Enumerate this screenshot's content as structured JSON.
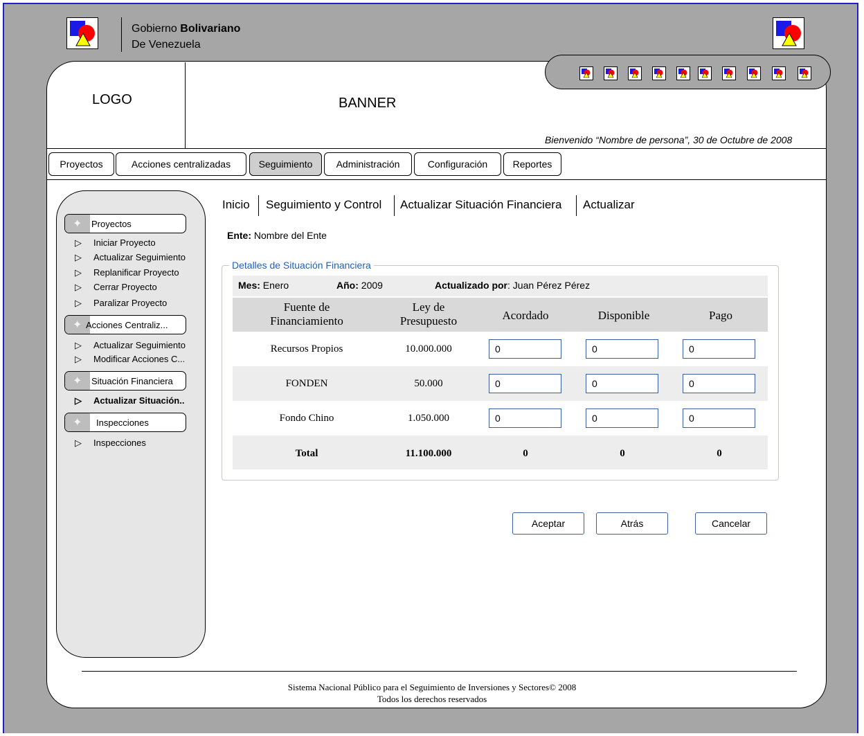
{
  "header": {
    "gov_line1_prefix": "Gobierno",
    "gov_line1_bold": "Bolivariano",
    "gov_line2": "De Venezuela",
    "logo": "LOGO",
    "banner": "BANNER",
    "welcome": "Bienvenido “Nombre de persona”, 30 de Octubre de 2008",
    "icon_count": 10
  },
  "nav": {
    "tabs": [
      {
        "label": "Proyectos"
      },
      {
        "label": "Acciones centralizadas"
      },
      {
        "label": "Seguimiento"
      },
      {
        "label": "Administración"
      },
      {
        "label": "Configuración"
      },
      {
        "label": "Reportes"
      }
    ],
    "active": "Seguimiento"
  },
  "sidebar": {
    "groups": [
      {
        "label": "Proyectos",
        "items": [
          "Iniciar Proyecto",
          "Actualizar Seguimiento",
          "Replanificar Proyecto",
          "Cerrar Proyecto",
          "Paralizar Proyecto"
        ]
      },
      {
        "label": "Acciones Centraliz...",
        "items": [
          "Actualizar Seguimiento",
          "Modificar Acciones C..."
        ]
      },
      {
        "label": "Situación Financiera",
        "items": [
          "Actualizar Situación.."
        ]
      },
      {
        "label": "Inspecciones",
        "items": [
          "Inspecciones"
        ]
      }
    ]
  },
  "breadcrumb": [
    "Inicio",
    "Seguimiento y Control",
    "Actualizar Situación Financiera",
    "Actualizar"
  ],
  "ente": {
    "label": "Ente:",
    "value": "Nombre del Ente"
  },
  "details": {
    "legend": "Detalles de Situación Financiera",
    "mes_label": "Mes:",
    "mes": "Enero",
    "anio_label": "Año:",
    "anio": "2009",
    "actualizado_label": "Actualizado por",
    "actualizado": ": Juan Pérez Pérez",
    "columns": [
      {
        "line1": "Fuente de",
        "line2": "Financiamiento"
      },
      {
        "line1": "Ley de",
        "line2": "Presupuesto"
      },
      {
        "line1": "Acordado",
        "line2": ""
      },
      {
        "line1": "Disponible",
        "line2": ""
      },
      {
        "line1": "Pago",
        "line2": ""
      }
    ],
    "rows": [
      {
        "fuente": "Recursos Propios",
        "ley": "10.000.000",
        "acordado": "0",
        "disponible": "0",
        "pago": "0"
      },
      {
        "fuente": "FONDEN",
        "ley": "50.000",
        "acordado": "0",
        "disponible": "0",
        "pago": "0"
      },
      {
        "fuente": "Fondo Chino",
        "ley": "1.050.000",
        "acordado": "0",
        "disponible": "0",
        "pago": "0"
      }
    ],
    "total": {
      "label": "Total",
      "ley": "11.100.000",
      "acordado": "0",
      "disponible": "0",
      "pago": "0"
    }
  },
  "buttons": {
    "aceptar": "Aceptar",
    "atras": "Atrás",
    "cancelar": "Cancelar"
  },
  "footer": {
    "line1": "Sistema Nacional Público para el Seguimiento de Inversiones y Sectores© 2008",
    "line2": "Todos los derechos reservados"
  }
}
